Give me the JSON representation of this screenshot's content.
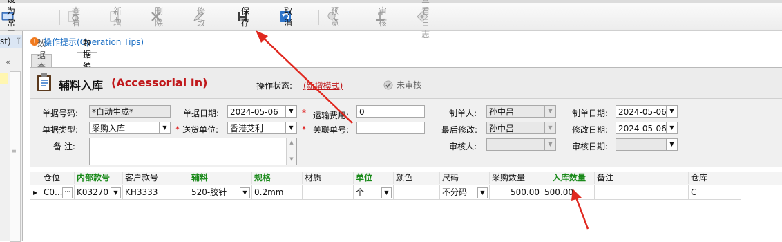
{
  "toolbar": {
    "set_common": "设为常用",
    "view": "查看",
    "add": "新增",
    "delete": "删除",
    "modify": "修改",
    "save": "保存",
    "cancel": "取消",
    "preview": "预览",
    "audit": "审核",
    "view_log": "查看日志"
  },
  "left_panel": {
    "title_fragment": "st)"
  },
  "tips": {
    "label": "操作提示(Operation Tips)"
  },
  "tabs": [
    {
      "label": "数据查询"
    },
    {
      "label": "数据编辑"
    }
  ],
  "header": {
    "title_cn": "辅料入库",
    "title_en": "(Accessorial In)",
    "op_status_label": "操作状态:",
    "op_status_value": "(新增模式)",
    "audit_status": "未审核"
  },
  "form": {
    "doc_no_label": "单据号码:",
    "doc_no_value": "*自动生成*",
    "doc_date_label": "单据日期:",
    "doc_date_value": "2024-05-06",
    "freight_label": "运输费用:",
    "freight_value": "0",
    "creator_label": "制单人:",
    "creator_value": "孙中吕",
    "create_date_label": "制单日期:",
    "create_date_value": "2024-05-06",
    "doc_type_label": "单据类型:",
    "doc_type_value": "采购入库",
    "supplier_label": "送货单位:",
    "supplier_value": "香港艾利",
    "ref_no_label": "关联单号:",
    "ref_no_value": "",
    "last_modifier_label": "最后修改:",
    "last_modifier_value": "孙中吕",
    "modify_date_label": "修改日期:",
    "modify_date_value": "2024-05-06",
    "remark_label": "备 注:",
    "remark_value": "",
    "auditor_label": "审核人:",
    "auditor_value": "",
    "audit_date_label": "审核日期:",
    "audit_date_value": ""
  },
  "grid": {
    "headers": [
      "仓位",
      "内部款号",
      "客户款号",
      "辅料",
      "规格",
      "材质",
      "单位",
      "颜色",
      "尺码",
      "采购数量",
      "入库数量",
      "备注",
      "仓库"
    ],
    "row": [
      "C0...",
      "K03270",
      "KH3333",
      "520-胶针",
      "0.2mm",
      "",
      "个",
      "",
      "不分码",
      "500.00",
      "500.00",
      "",
      "C"
    ]
  },
  "colors": {
    "accent_red": "#c0181b",
    "header_green": "#1a8a1a",
    "tips_blue": "#1c6fc4",
    "arrow_red": "#e0281f"
  }
}
